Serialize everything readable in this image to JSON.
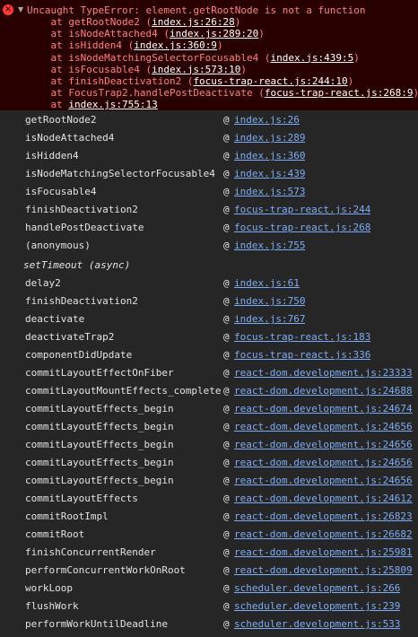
{
  "error": {
    "icon": "error-circle-icon",
    "icon_glyph": "✕",
    "caret_glyph": "▼",
    "message": "Uncaught TypeError: element.getRootNode is not a function",
    "trace": [
      {
        "prefix": "    at getRootNode2 (",
        "location": "index.js:26:28",
        "suffix": ")"
      },
      {
        "prefix": "    at isNodeAttached4 (",
        "location": "index.js:289:20",
        "suffix": ")"
      },
      {
        "prefix": "    at isHidden4 (",
        "location": "index.js:360:9",
        "suffix": ")"
      },
      {
        "prefix": "    at isNodeMatchingSelectorFocusable4 (",
        "location": "index.js:439:5",
        "suffix": ")"
      },
      {
        "prefix": "    at isFocusable4 (",
        "location": "index.js:573:10",
        "suffix": ")"
      },
      {
        "prefix": "    at finishDeactivation2 (",
        "location": "focus-trap-react.js:244:10",
        "suffix": ")"
      },
      {
        "prefix": "    at FocusTrap2.handlePostDeactivate (",
        "location": "focus-trap-react.js:268:9",
        "suffix": ")"
      },
      {
        "prefix": "    at ",
        "location": "index.js:755:13",
        "suffix": ""
      }
    ]
  },
  "stack": {
    "at_symbol": "@",
    "frames_sync": [
      {
        "fn": "getRootNode2",
        "link": "index.js:26"
      },
      {
        "fn": "isNodeAttached4",
        "link": "index.js:289"
      },
      {
        "fn": "isHidden4",
        "link": "index.js:360"
      },
      {
        "fn": "isNodeMatchingSelectorFocusable4",
        "link": "index.js:439"
      },
      {
        "fn": "isFocusable4",
        "link": "index.js:573"
      },
      {
        "fn": "finishDeactivation2",
        "link": "focus-trap-react.js:244"
      },
      {
        "fn": "handlePostDeactivate",
        "link": "focus-trap-react.js:268"
      },
      {
        "fn": "(anonymous)",
        "link": "index.js:755"
      }
    ],
    "async_label": "setTimeout (async)",
    "frames_async": [
      {
        "fn": "delay2",
        "link": "index.js:61"
      },
      {
        "fn": "finishDeactivation2",
        "link": "index.js:750"
      },
      {
        "fn": "deactivate",
        "link": "index.js:767"
      },
      {
        "fn": "deactivateTrap2",
        "link": "focus-trap-react.js:183"
      },
      {
        "fn": "componentDidUpdate",
        "link": "focus-trap-react.js:336"
      },
      {
        "fn": "commitLayoutEffectOnFiber",
        "link": "react-dom.development.js:23333"
      },
      {
        "fn": "commitLayoutMountEffects_complete",
        "link": "react-dom.development.js:24688"
      },
      {
        "fn": "commitLayoutEffects_begin",
        "link": "react-dom.development.js:24674"
      },
      {
        "fn": "commitLayoutEffects_begin",
        "link": "react-dom.development.js:24656"
      },
      {
        "fn": "commitLayoutEffects_begin",
        "link": "react-dom.development.js:24656"
      },
      {
        "fn": "commitLayoutEffects_begin",
        "link": "react-dom.development.js:24656"
      },
      {
        "fn": "commitLayoutEffects_begin",
        "link": "react-dom.development.js:24656"
      },
      {
        "fn": "commitLayoutEffects",
        "link": "react-dom.development.js:24612"
      },
      {
        "fn": "commitRootImpl",
        "link": "react-dom.development.js:26823"
      },
      {
        "fn": "commitRoot",
        "link": "react-dom.development.js:26682"
      },
      {
        "fn": "finishConcurrentRender",
        "link": "react-dom.development.js:25981"
      },
      {
        "fn": "performConcurrentWorkOnRoot",
        "link": "react-dom.development.js:25809"
      },
      {
        "fn": "workLoop",
        "link": "scheduler.development.js:266"
      },
      {
        "fn": "flushWork",
        "link": "scheduler.development.js:239"
      },
      {
        "fn": "performWorkUntilDeadline",
        "link": "scheduler.development.js:533"
      }
    ]
  },
  "colors": {
    "background": "#262626",
    "error_background": "#290000",
    "error_text": "#ff8080",
    "link": "#7cacf8",
    "text": "#e3e3e3"
  }
}
